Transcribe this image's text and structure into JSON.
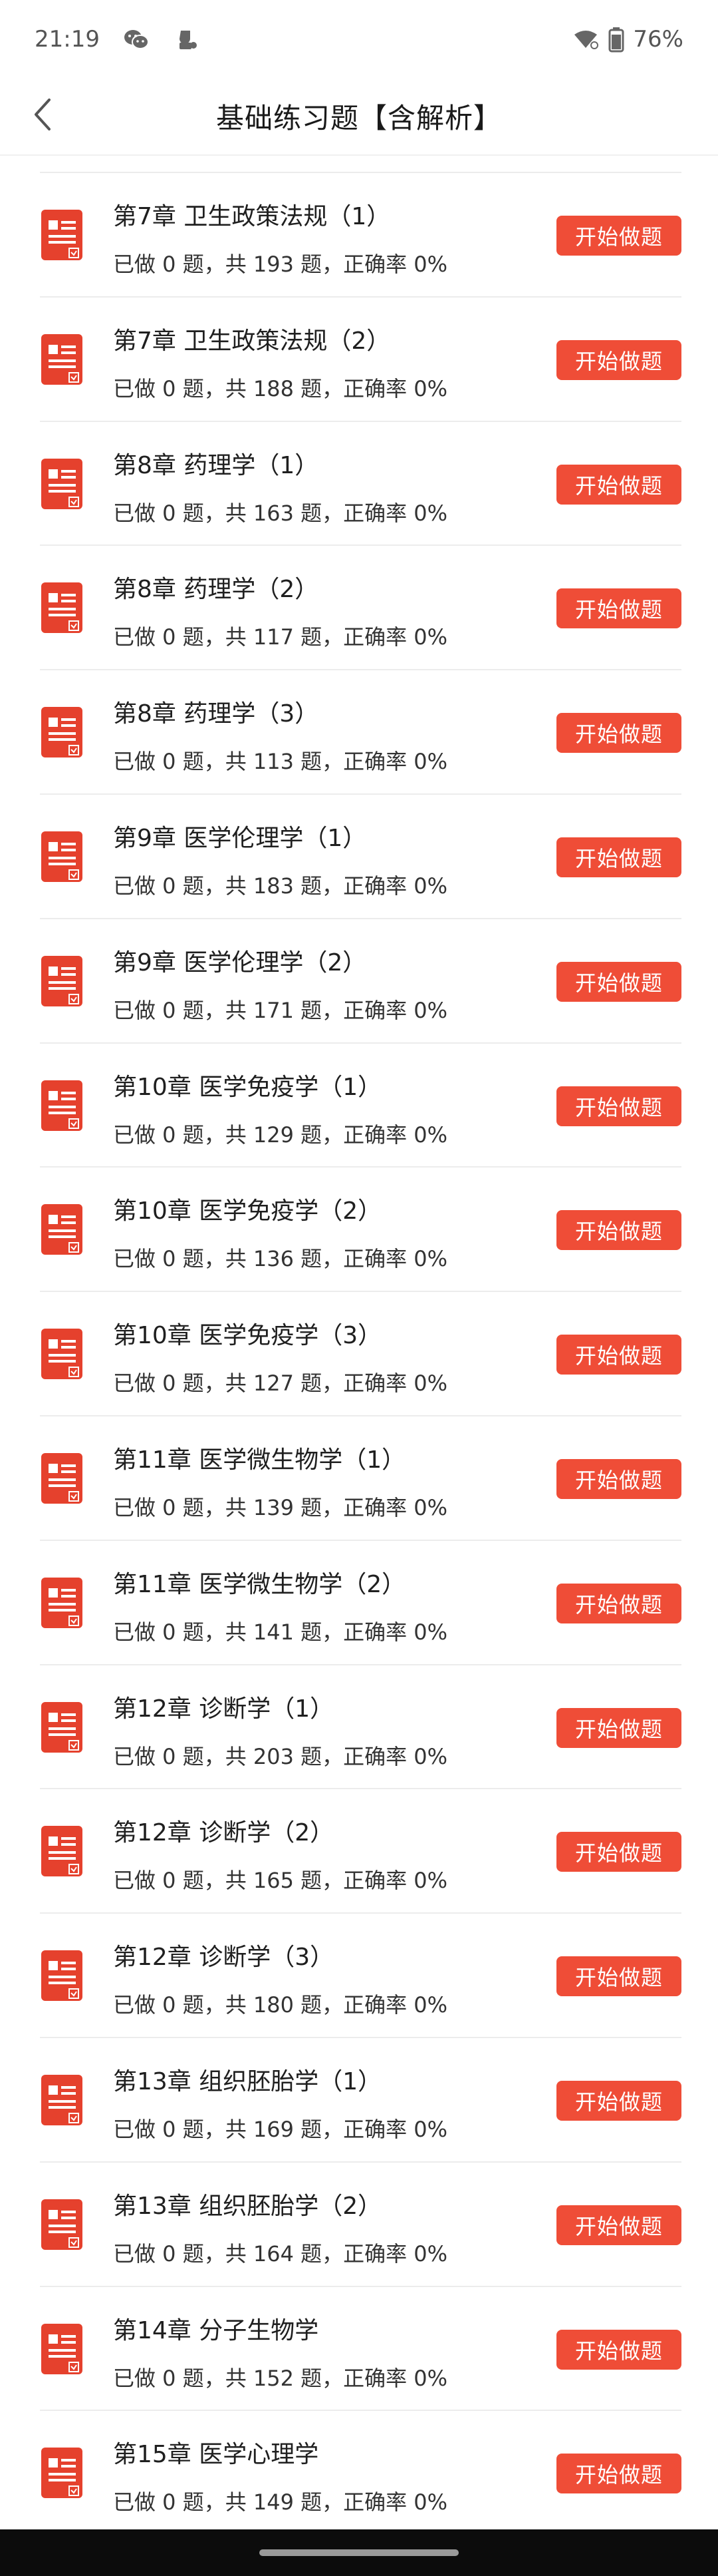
{
  "status_bar": {
    "time": "21:19",
    "battery": "76%"
  },
  "header": {
    "title": "基础练习题【含解析】"
  },
  "action_label": "开始做题",
  "items": [
    {
      "title": "第7章 卫生政策法规（1）",
      "stats": "已做 0 题，共 193 题，正确率 0%"
    },
    {
      "title": "第7章 卫生政策法规（2）",
      "stats": "已做 0 题，共 188 题，正确率 0%"
    },
    {
      "title": "第8章 药理学（1）",
      "stats": "已做 0 题，共 163 题，正确率 0%"
    },
    {
      "title": "第8章 药理学（2）",
      "stats": "已做 0 题，共 117 题，正确率 0%"
    },
    {
      "title": "第8章 药理学（3）",
      "stats": "已做 0 题，共 113 题，正确率 0%"
    },
    {
      "title": "第9章 医学伦理学（1）",
      "stats": "已做 0 题，共 183 题，正确率 0%"
    },
    {
      "title": "第9章 医学伦理学（2）",
      "stats": "已做 0 题，共 171 题，正确率 0%"
    },
    {
      "title": "第10章 医学免疫学（1）",
      "stats": "已做 0 题，共 129 题，正确率 0%"
    },
    {
      "title": "第10章 医学免疫学（2）",
      "stats": "已做 0 题，共 136 题，正确率 0%"
    },
    {
      "title": "第10章 医学免疫学（3）",
      "stats": "已做 0 题，共 127 题，正确率 0%"
    },
    {
      "title": "第11章 医学微生物学（1）",
      "stats": "已做 0 题，共 139 题，正确率 0%"
    },
    {
      "title": "第11章 医学微生物学（2）",
      "stats": "已做 0 题，共 141 题，正确率 0%"
    },
    {
      "title": "第12章 诊断学（1）",
      "stats": "已做 0 题，共 203 题，正确率 0%"
    },
    {
      "title": "第12章 诊断学（2）",
      "stats": "已做 0 题，共 165 题，正确率 0%"
    },
    {
      "title": "第12章 诊断学（3）",
      "stats": "已做 0 题，共 180 题，正确率 0%"
    },
    {
      "title": "第13章 组织胚胎学（1）",
      "stats": "已做 0 题，共 169 题，正确率 0%"
    },
    {
      "title": "第13章 组织胚胎学（2）",
      "stats": "已做 0 题，共 164 题，正确率 0%"
    },
    {
      "title": "第14章 分子生物学",
      "stats": "已做 0 题，共 152 题，正确率 0%"
    },
    {
      "title": "第15章 医学心理学",
      "stats": "已做 0 题，共 149 题，正确率 0%"
    }
  ],
  "icons": {
    "back": "chevron-left-icon",
    "item": "exercise-doc-icon",
    "wechat": "wechat-icon",
    "notification": "app-notification-icon",
    "wifi": "wifi-icon",
    "battery": "battery-icon"
  },
  "colors": {
    "accent": "#ef4d37",
    "title_text": "#1a1a1a",
    "divider": "#ececec"
  }
}
